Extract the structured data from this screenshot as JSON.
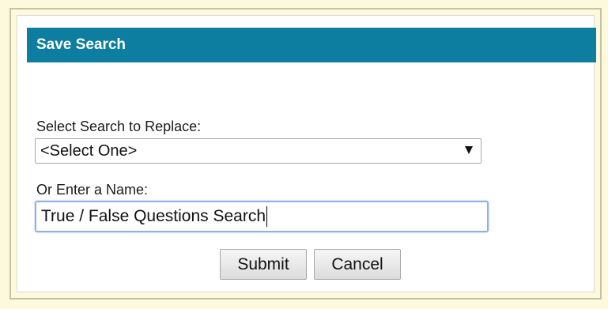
{
  "dialog": {
    "title": "Save Search",
    "replace": {
      "label": "Select Search to Replace:",
      "selected": "<Select One>"
    },
    "name": {
      "label": "Or Enter a Name:",
      "value": "True / False Questions Search"
    },
    "buttons": {
      "submit": "Submit",
      "cancel": "Cancel"
    }
  },
  "colors": {
    "header": "#0d7e9f",
    "background": "#fcf9dc",
    "focus_border": "#8fb1e6"
  },
  "icons": {
    "dropdown": "chevron-down-icon"
  }
}
